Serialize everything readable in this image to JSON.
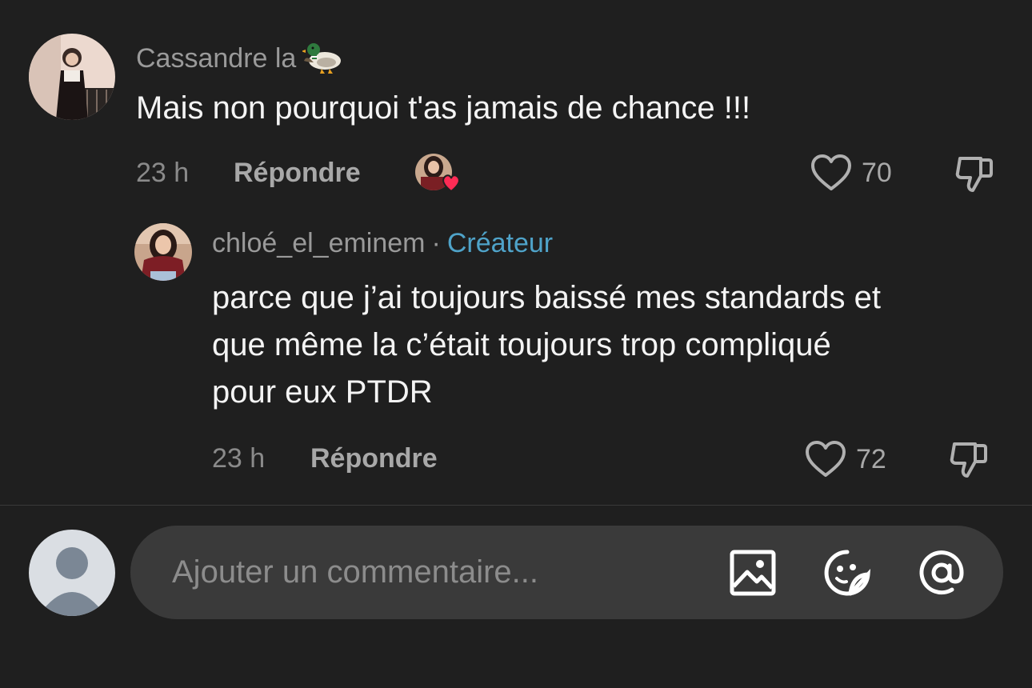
{
  "comment": {
    "username": "Cassandre la",
    "username_icon": "duck-emoji",
    "text": "Mais non pourquoi t'as jamais de chance !!!",
    "time": "23 h",
    "reply_label": "Répondre",
    "like_count": "70",
    "creator_liked_icon": "heart-badge-icon"
  },
  "reply": {
    "username": "chloé_el_eminem",
    "separator": "·",
    "badge": "Créateur",
    "text_lines": [
      "parce que j’ai toujours baissé mes standards et",
      "que même la c’était toujours trop compliqué",
      "pour eux PTDR"
    ],
    "time": "23 h",
    "reply_label": "Répondre",
    "like_count": "72"
  },
  "composer": {
    "placeholder": "Ajouter un commentaire...",
    "icons": [
      "image-icon",
      "sticker-icon",
      "at-mention-icon"
    ]
  },
  "colors": {
    "background": "#1f1f1f",
    "creator_badge": "#4fa3c9",
    "heart": "#fe2c55"
  }
}
